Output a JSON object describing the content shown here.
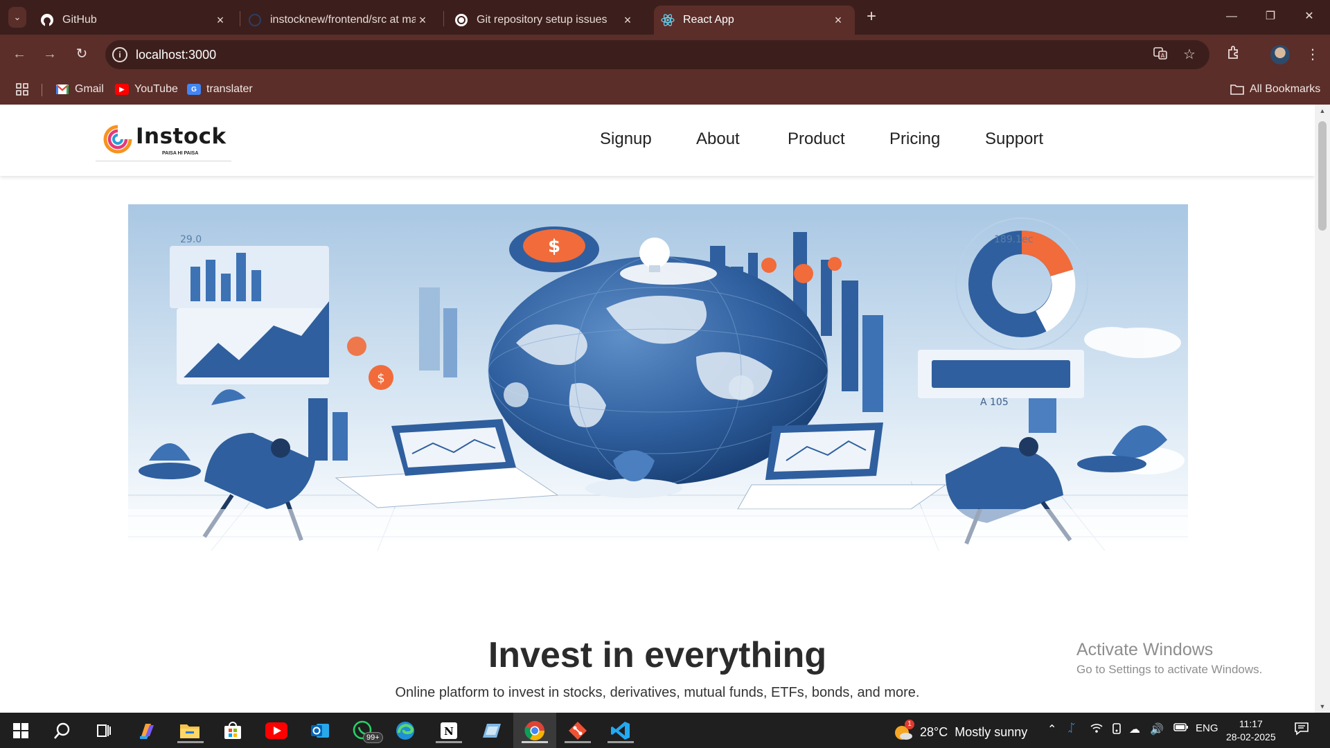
{
  "browser": {
    "tabs": [
      {
        "title": "GitHub",
        "icon": "github-icon",
        "active": false
      },
      {
        "title": "instocknew/frontend/src at mai",
        "icon": "github-icon",
        "active": false
      },
      {
        "title": "Git repository setup issues",
        "icon": "chatgpt-icon",
        "active": false
      },
      {
        "title": "React App",
        "icon": "react-icon",
        "active": true
      }
    ],
    "url": "localhost:3000",
    "bookmarks": [
      {
        "label": "Gmail",
        "icon": "gmail-icon"
      },
      {
        "label": "YouTube",
        "icon": "youtube-icon"
      },
      {
        "label": "translater",
        "icon": "translate-icon"
      }
    ],
    "all_bookmarks_label": "All Bookmarks",
    "colors": {
      "frame": "#3c1f1c",
      "toolbar": "#5b2e29"
    }
  },
  "site": {
    "logo": {
      "name": "Instock",
      "tagline": "PAISA HI PAISA"
    },
    "nav": [
      {
        "label": "Signup"
      },
      {
        "label": "About"
      },
      {
        "label": "Product"
      },
      {
        "label": "Pricing"
      },
      {
        "label": "Support"
      }
    ],
    "hero": {
      "labels": [
        "29.0",
        "189.1ec",
        "A 105"
      ]
    },
    "headline": "Invest in everything",
    "subheadline": "Online platform to invest in stocks, derivatives, mutual funds, ETFs, bonds, and more."
  },
  "watermark": {
    "line1": "Activate Windows",
    "line2": "Go to Settings to activate Windows."
  },
  "taskbar": {
    "whatsapp_badge": "99+",
    "weather": {
      "temp": "28°C",
      "condition": "Mostly sunny",
      "alert_count": "1"
    },
    "language": "ENG",
    "time": "11:17",
    "date": "28-02-2025"
  }
}
